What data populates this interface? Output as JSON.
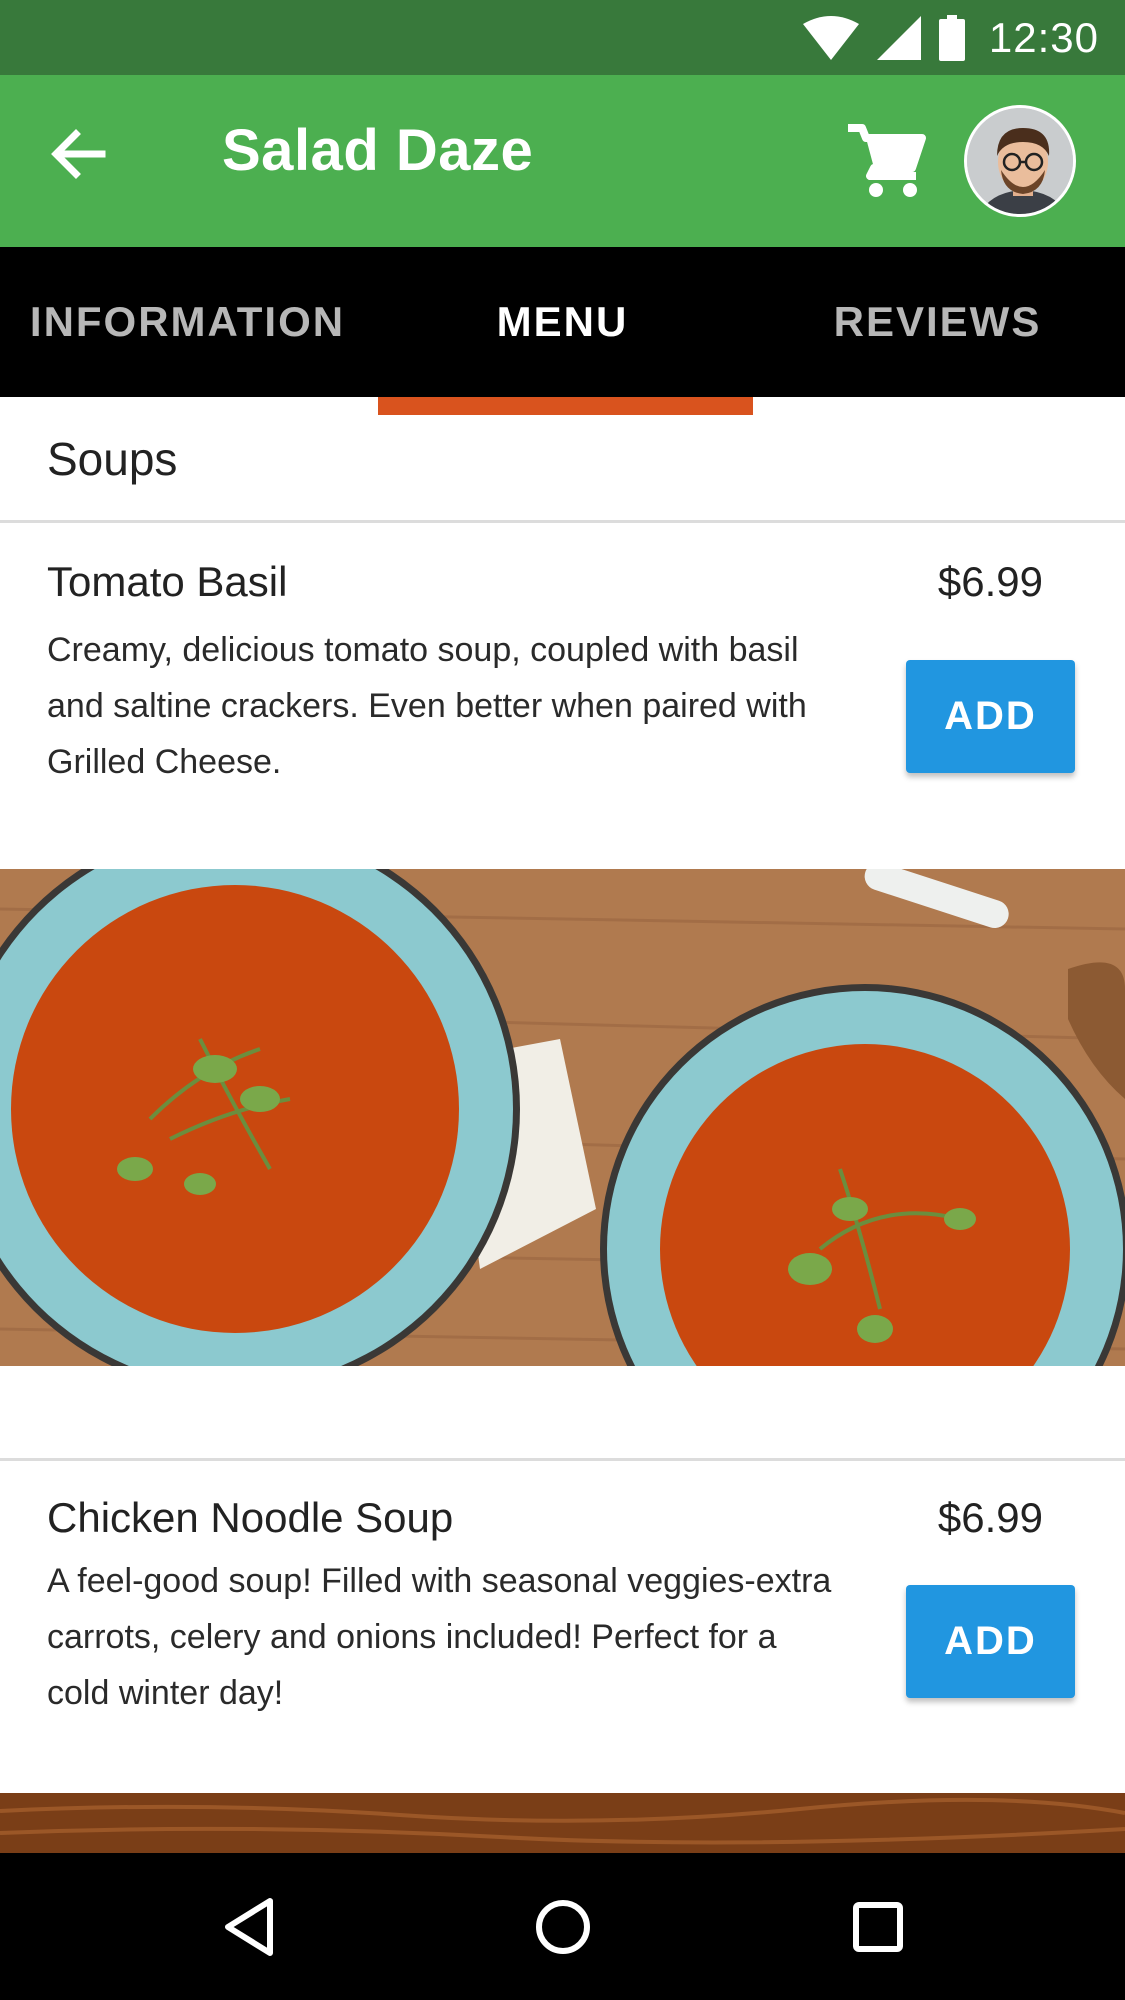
{
  "status_bar": {
    "time": "12:30"
  },
  "app_bar": {
    "title": "Salad Daze"
  },
  "tabs": [
    {
      "label": "INFORMATION",
      "active": false
    },
    {
      "label": "MENU",
      "active": true
    },
    {
      "label": "REVIEWS",
      "active": false
    }
  ],
  "section": {
    "title": "Soups"
  },
  "items": [
    {
      "name": "Tomato Basil",
      "price": "$6.99",
      "description": "Creamy, delicious tomato soup, coupled with basil and saltine crackers. Even better when paired with Grilled Cheese.",
      "button_label": "ADD"
    },
    {
      "name": "Chicken Noodle Soup",
      "price": "$6.99",
      "description": "A feel-good soup! Filled with seasonal veggies-extra carrots, celery and onions included! Perfect for a cold winter day!",
      "button_label": "ADD"
    }
  ],
  "colors": {
    "status_bar": "#38793b",
    "app_bar": "#4caf50",
    "tab_bar": "#000000",
    "tab_indicator": "#d9531e",
    "add_button": "#2196e0"
  },
  "icons": {
    "status": [
      "wifi-icon",
      "signal-icon",
      "battery-icon"
    ],
    "app_bar": [
      "back-arrow-icon",
      "cart-icon"
    ],
    "nav": [
      "nav-back-icon",
      "nav-home-icon",
      "nav-recents-icon"
    ]
  }
}
